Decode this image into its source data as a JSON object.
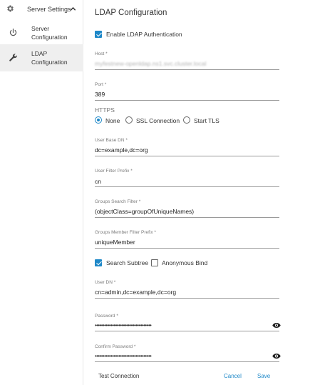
{
  "sidebar": {
    "header": "Server Settings",
    "items": [
      {
        "label": "Server\nConfiguration",
        "icon": "power-icon"
      },
      {
        "label": "LDAP\nConfiguration",
        "icon": "wrench-icon"
      }
    ]
  },
  "main": {
    "title": "LDAP Configuration",
    "enable_ldap": {
      "label": "Enable LDAP Authentication",
      "checked": true
    },
    "host": {
      "label": "Host *",
      "value": "myfestnew-openldap.ns1.svc.cluster.local"
    },
    "port": {
      "label": "Port *",
      "value": "389"
    },
    "https": {
      "label": "HTTPS",
      "options": [
        "None",
        "SSL Connection",
        "Start TLS"
      ],
      "selected": "None"
    },
    "user_base_dn": {
      "label": "User Base DN *",
      "value": "dc=example,dc=org"
    },
    "user_filter_prefix": {
      "label": "User Filter Prefix *",
      "value": "cn"
    },
    "groups_search_filter": {
      "label": "Groups Search Filter *",
      "value": "(objectClass=groupOfUniqueNames)"
    },
    "groups_member_filter_prefix": {
      "label": "Groups Member Filter Prefix *",
      "value": "uniqueMember"
    },
    "search_subtree": {
      "label": "Search Subtree",
      "checked": true
    },
    "anonymous_bind": {
      "label": "Anonymous Bind",
      "checked": false
    },
    "user_dn": {
      "label": "User DN *",
      "value": "cn=admin,dc=example,dc=org"
    },
    "password": {
      "label": "Password *",
      "value": "••••••••••••••••••••••••••••••••••••"
    },
    "confirm_password": {
      "label": "Confirm Password *",
      "value": "••••••••••••••••••••••••••••••••••••"
    },
    "buttons": {
      "test": "Test Connection",
      "cancel": "Cancel",
      "save": "Save"
    }
  },
  "colors": {
    "accent": "#1e88c8",
    "active_bg": "#efefef"
  }
}
